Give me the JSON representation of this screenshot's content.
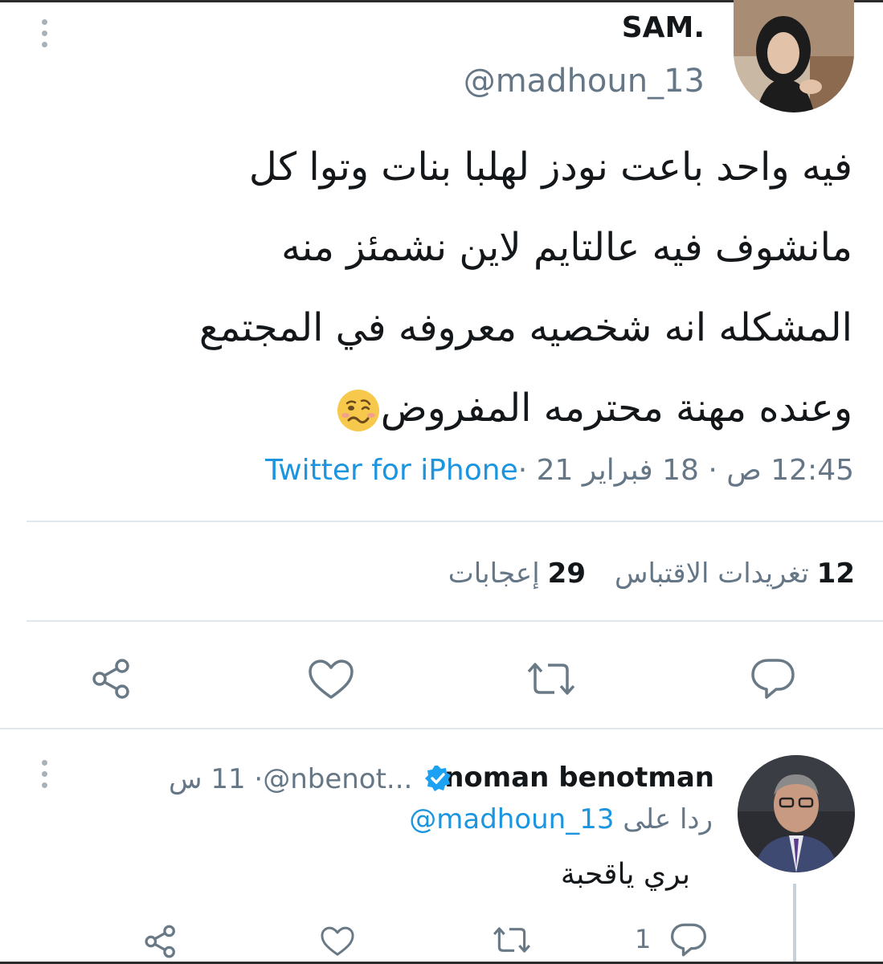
{
  "tweet": {
    "author_name": "SAM.",
    "author_handle": "@madhoun_13",
    "lines": [
      "فيه واحد باعت نودز لهلبا بنات وتوا كل",
      "مانشوف فيه عالتايم لاين نشمئز منه",
      "المشكله انه شخصيه معروفه في المجتمع",
      "وعنده مهنة محترمه المفروض"
    ],
    "emoji": "woozy-face",
    "meta_time": "12:45 ص · 18 فبراير 21 · ",
    "meta_source": "Twitter for iPhone",
    "retweet_count": "12",
    "retweet_label": "تغريدات الاقتباس",
    "like_count": "29",
    "like_label": "إعجابات"
  },
  "reply": {
    "author_name": "noman benotman",
    "author_handle": "@nbenot...",
    "time": " · 11 س",
    "replying_to_label": "ردا على",
    "replying_to_handle": "@madhoun_13",
    "text": "بري ياقحبة",
    "reply_count": "1"
  },
  "icons": [
    "more-icon",
    "share-icon",
    "like-icon",
    "retweet-icon",
    "reply-icon",
    "verified-icon"
  ],
  "colors": {
    "link": "#1b95e0",
    "muted": "#657786",
    "text": "#14171a",
    "divider": "#e1e8ed",
    "action": "#697985"
  }
}
